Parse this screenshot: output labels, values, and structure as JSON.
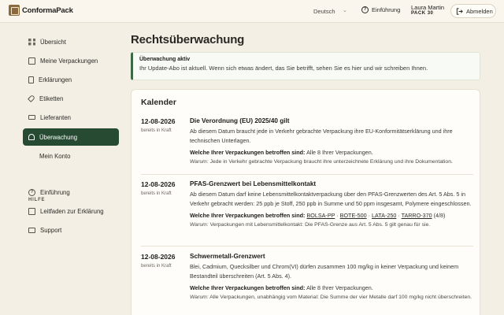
{
  "header": {
    "logo_text": "ConformaPack",
    "language": "Deutsch",
    "intro_label": "Einführung",
    "user_name": "Laura Martin",
    "user_pack": "PACK 30",
    "logout_label": "Abmelden"
  },
  "sidebar": {
    "items": [
      {
        "label": "Übersicht",
        "icon": "grid-icon"
      },
      {
        "label": "Meine Verpackungen",
        "icon": "box-icon"
      },
      {
        "label": "Erklärungen",
        "icon": "document-icon"
      },
      {
        "label": "Etiketten",
        "icon": "tag-icon"
      },
      {
        "label": "Lieferanten",
        "icon": "truck-icon"
      },
      {
        "label": "Überwachung",
        "icon": "bell-icon",
        "active": true
      },
      {
        "label": "Mein Konto",
        "icon": "user-icon"
      }
    ],
    "help_heading": "HILFE",
    "help_items": [
      {
        "label": "Einführung",
        "icon": "help-circle-icon"
      },
      {
        "label": "Leitfaden zur Erklärung",
        "icon": "book-icon"
      },
      {
        "label": "Support",
        "icon": "mail-icon"
      }
    ]
  },
  "main": {
    "title": "Rechtsüberwachung",
    "alert": {
      "title": "Überwachung aktiv",
      "text": "Ihr Update-Abo ist aktuell. Wenn sich etwas ändert, das Sie betrifft, sehen Sie es hier und wir schreiben Ihnen."
    },
    "calendar": {
      "title": "Kalender",
      "entries": [
        {
          "date": "12-08-2026",
          "status": "bereits in Kraft",
          "title": "Die Verordnung (EU) 2025/40 gilt",
          "desc": "Ab diesem Datum braucht jede in Verkehr gebrachte Verpackung ihre EU-Konformitätserklärung und ihre technischen Unterlagen.",
          "affected_label": "Welche Ihrer Verpackungen betroffen sind:",
          "affected_value": "Alle 8 Ihrer Verpackungen.",
          "why_label": "Warum:",
          "why_text": "Jede in Verkehr gebrachte Verpackung braucht ihre unterzeichnete Erklärung und ihre Dokumentation."
        },
        {
          "date": "12-08-2026",
          "status": "bereits in Kraft",
          "title": "PFAS-Grenzwert bei Lebensmittelkontakt",
          "desc": "Ab diesem Datum darf keine Lebensmittelkontaktverpackung über den PFAS-Grenzwerten des Art. 5 Abs. 5 in Verkehr gebracht werden: 25 ppb je Stoff, 250 ppb in Summe und 50 ppm insgesamt, Polymere eingeschlossen.",
          "affected_label": "Welche Ihrer Verpackungen betroffen sind:",
          "affected_links": [
            "BOLSA-PP",
            "BOTE-500",
            "LATA-250",
            "TARRO-370"
          ],
          "affected_count": "(4/8)",
          "why_label": "Warum:",
          "why_text": "Verpackungen mit Lebensmittelkontakt: Die PFAS-Grenze aus Art. 5 Abs. 5 gilt genau für sie."
        },
        {
          "date": "12-08-2026",
          "status": "bereits in Kraft",
          "title": "Schwermetall-Grenzwert",
          "desc": "Blei, Cadmium, Quecksilber und Chrom(VI) dürfen zusammen 100 mg/kg in keiner Verpackung und keinem Bestandteil überschreiten (Art. 5 Abs. 4).",
          "affected_label": "Welche Ihrer Verpackungen betroffen sind:",
          "affected_value": "Alle 8 Ihrer Verpackungen.",
          "why_label": "Warum:",
          "why_text": "Alle Verpackungen, unabhängig vom Material: Die Summe der vier Metalle darf 100 mg/kg nicht überschreiten."
        }
      ]
    }
  }
}
